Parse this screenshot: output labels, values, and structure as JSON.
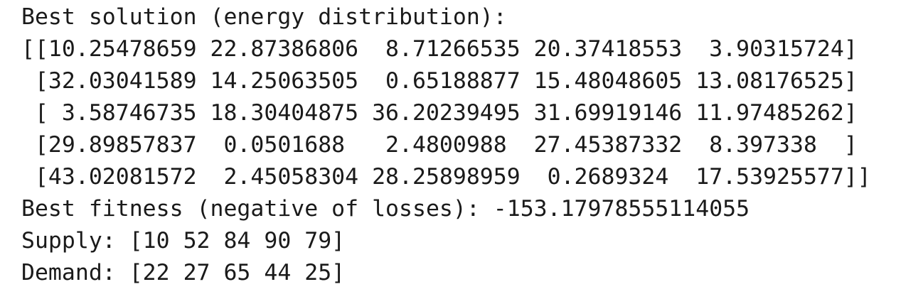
{
  "output": {
    "heading": "Best solution (energy distribution):",
    "matrix_rows": [
      "[[10.25478659 22.87386806  8.71266535 20.37418553  3.90315724]",
      " [32.03041589 14.25063505  0.65188877 15.48048605 13.08176525]",
      " [ 3.58746735 18.30404875 36.20239495 31.69919146 11.97485262]",
      " [29.89857837  0.0501688   2.4800988  27.45387332  8.397338  ]",
      " [43.02081572  2.45058304 28.25898959  0.2689324  17.53925577]]"
    ],
    "fitness_line": "Best fitness (negative of losses): -153.17978555114055",
    "supply_line": "Supply: [10 52 84 90 79]",
    "demand_line": "Demand: [22 27 65 44 25]"
  }
}
